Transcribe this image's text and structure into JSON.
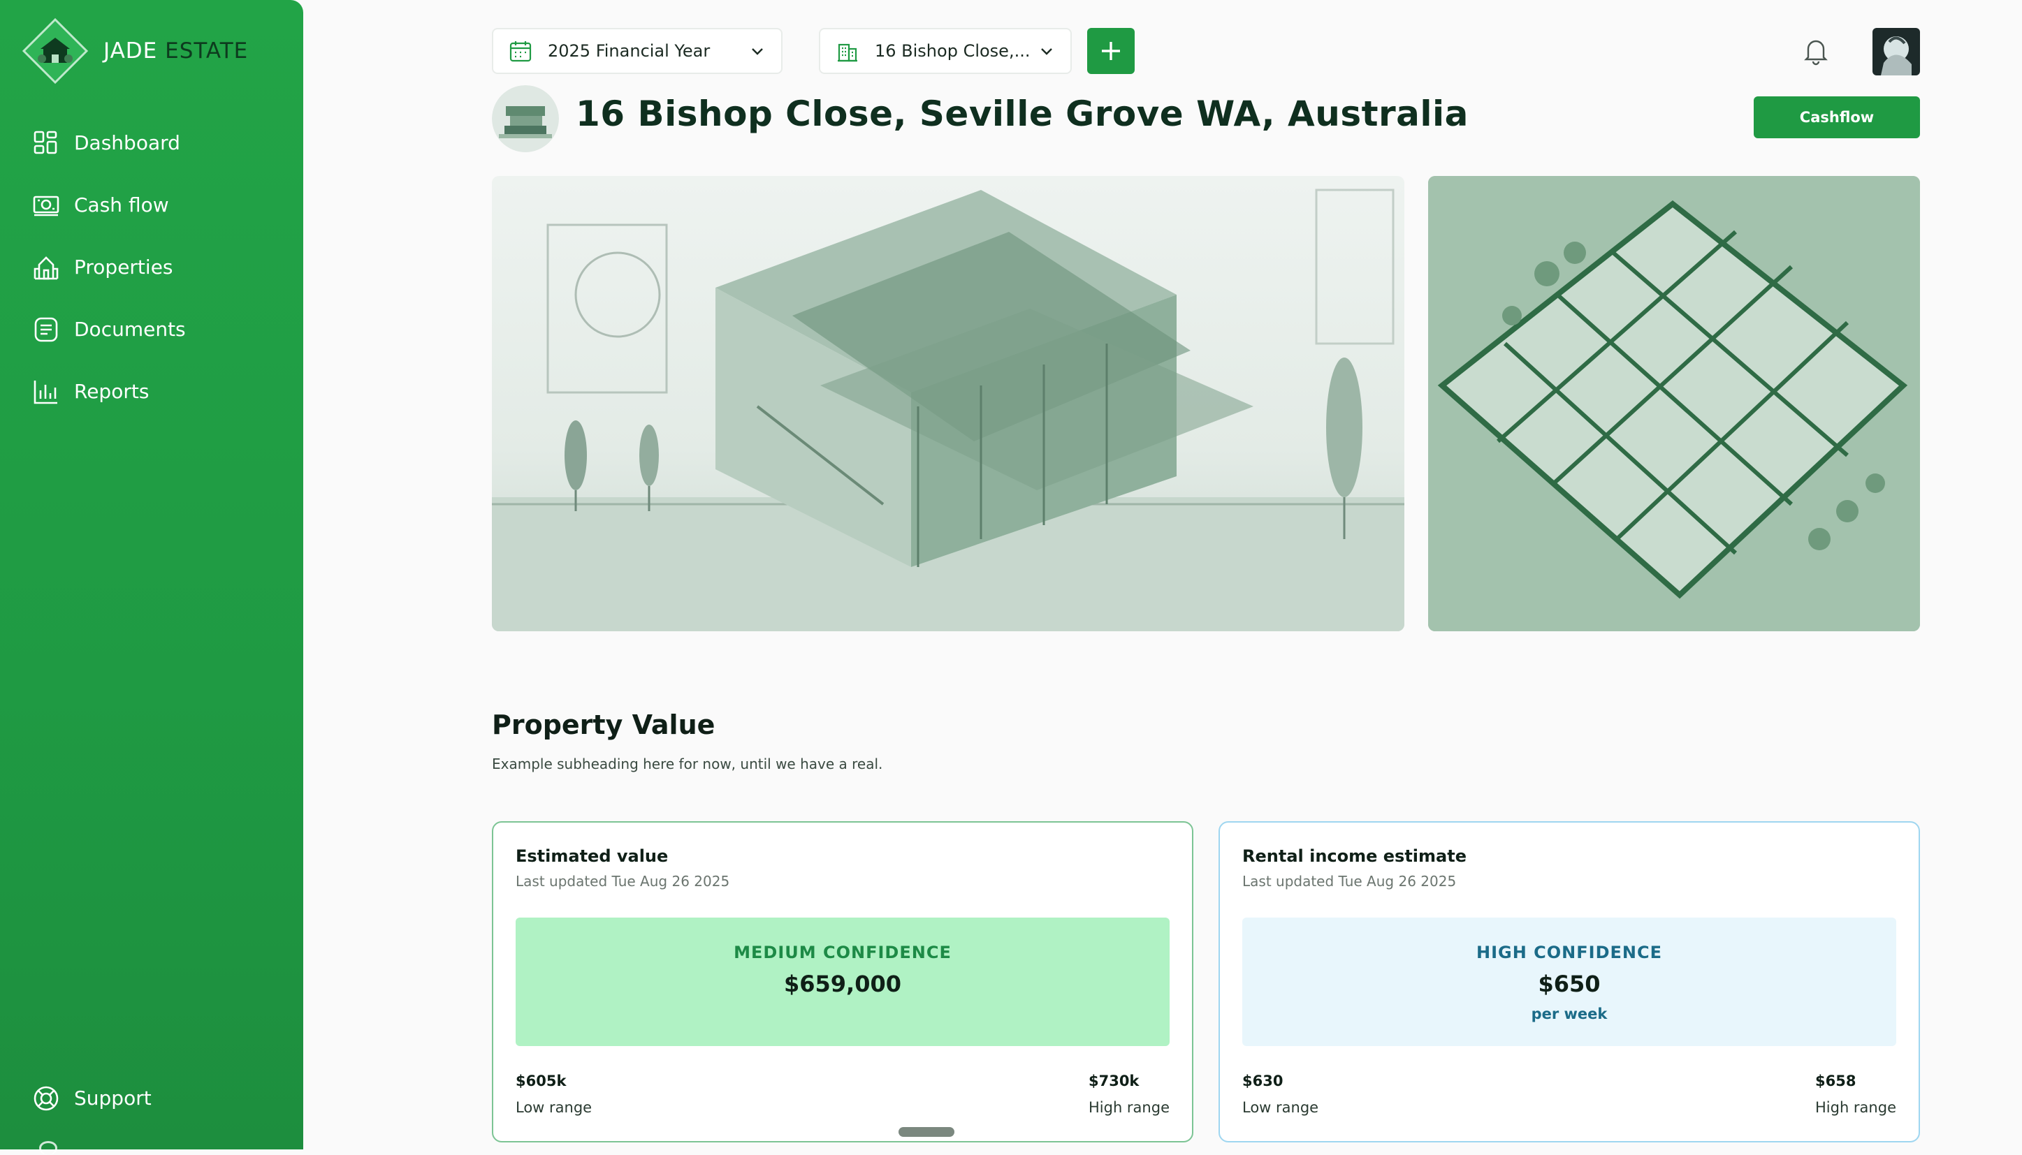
{
  "brand": {
    "name_part1": "JADE",
    "name_part2": "ESTATE"
  },
  "sidebar": {
    "items": [
      {
        "label": "Dashboard",
        "icon": "dashboard-icon"
      },
      {
        "label": "Cash flow",
        "icon": "cash-icon"
      },
      {
        "label": "Properties",
        "icon": "properties-icon"
      },
      {
        "label": "Documents",
        "icon": "documents-icon"
      },
      {
        "label": "Reports",
        "icon": "reports-icon"
      }
    ],
    "support_label": "Support"
  },
  "topbar": {
    "year_selector": "2025 Financial Year",
    "property_selector": "16 Bishop Close,...",
    "add_icon": "plus-icon",
    "notification_icon": "bell-icon"
  },
  "header": {
    "title": "16 Bishop Close, Seville Grove WA, Australia",
    "cashflow_button": "Cashflow"
  },
  "property_value": {
    "title": "Property Value",
    "subtitle": "Example subheading here for now, until we have a real."
  },
  "estimated_value": {
    "title": "Estimated value",
    "updated": "Last updated Tue Aug 26 2025",
    "confidence": "MEDIUM CONFIDENCE",
    "value": "$659,000",
    "low_value": "$605k",
    "low_label": "Low range",
    "high_value": "$730k",
    "high_label": "High range"
  },
  "rental_estimate": {
    "title": "Rental income estimate",
    "updated": "Last updated Tue Aug 26 2025",
    "confidence": "HIGH CONFIDENCE",
    "value": "$650",
    "per": "per week",
    "low_value": "$630",
    "low_label": "Low range",
    "high_value": "$658",
    "high_label": "High range"
  },
  "colors": {
    "brand_green": "#1f9a43",
    "medium_confidence_bg": "#b0f2c4",
    "high_confidence_bg": "#e8f6fc"
  }
}
